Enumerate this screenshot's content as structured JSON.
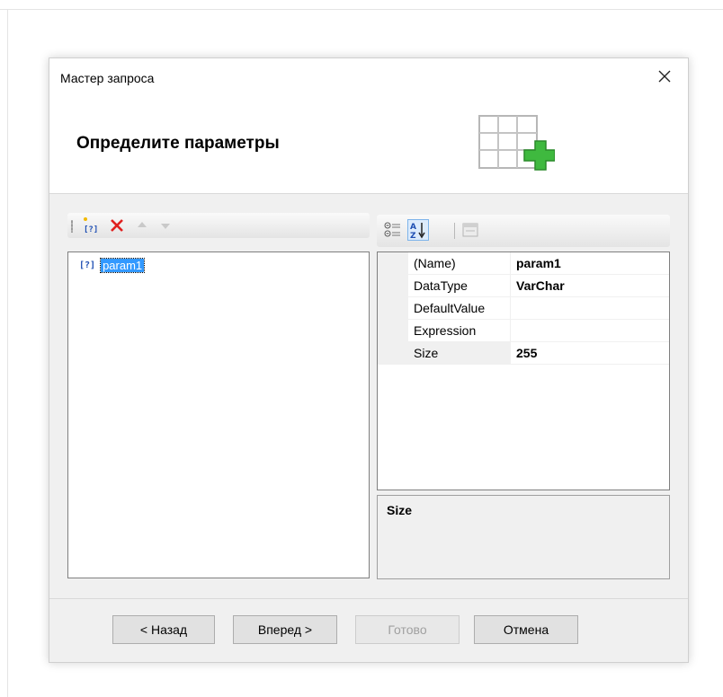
{
  "dialog": {
    "title": "Мастер запроса",
    "heading": "Определите параметры",
    "close_icon": "close-icon",
    "header_icon": "table-add-icon"
  },
  "params_toolbar": {
    "icons": [
      "add-parameter-icon",
      "delete-icon",
      "move-up-icon",
      "move-down-icon"
    ]
  },
  "params_list": {
    "items": [
      {
        "icon_text": "[?]",
        "label": "param1"
      }
    ]
  },
  "properties_toolbar": {
    "icons": [
      "categorized-icon",
      "sort-alphabetical-icon",
      "property-pages-icon"
    ],
    "az_top": "A",
    "az_bottom": "Z",
    "az_arrow": "↓"
  },
  "properties": {
    "rows": [
      {
        "name": "(Name)",
        "value": "param1"
      },
      {
        "name": "DataType",
        "value": "VarChar"
      },
      {
        "name": "DefaultValue",
        "value": ""
      },
      {
        "name": "Expression",
        "value": ""
      },
      {
        "name": "Size",
        "value": "255"
      }
    ],
    "selected": "Size"
  },
  "description": {
    "title": "Size"
  },
  "buttons": {
    "back": "< Назад",
    "next": "Вперед >",
    "finish": "Готово",
    "cancel": "Отмена"
  },
  "colors": {
    "selection": "#3399ff",
    "delete_red": "#e0201f",
    "plus_green": "#3fb93f"
  }
}
